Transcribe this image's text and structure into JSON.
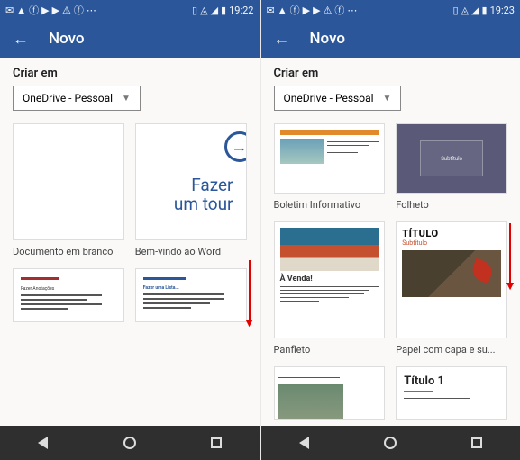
{
  "left": {
    "status": {
      "time": "19:22"
    },
    "appbar": {
      "title": "Novo"
    },
    "section_label": "Criar em",
    "dropdown": {
      "value": "OneDrive - Pessoal"
    },
    "templates": [
      {
        "label": "Documento em branco"
      },
      {
        "label": "Bem-vindo ao Word",
        "tour_line1": "Fazer",
        "tour_line2": "um tour"
      },
      {
        "label": "",
        "heading": "Fazer Anotações"
      },
      {
        "label": "",
        "heading": "Fazer uma Lista..."
      }
    ]
  },
  "right": {
    "status": {
      "time": "19:23"
    },
    "appbar": {
      "title": "Novo"
    },
    "section_label": "Criar em",
    "dropdown": {
      "value": "OneDrive - Pessoal"
    },
    "templates": [
      {
        "label": "Boletim Informativo"
      },
      {
        "label": "Folheto",
        "inner": "Subtítulo"
      },
      {
        "label": "Panfleto",
        "heading": "À Venda!"
      },
      {
        "label": "Papel com capa e su...",
        "title": "TÍTULO",
        "subtitle": "Subtítulo"
      },
      {
        "label": "",
        "img": true
      },
      {
        "label": "",
        "title1": "Título 1"
      }
    ]
  }
}
